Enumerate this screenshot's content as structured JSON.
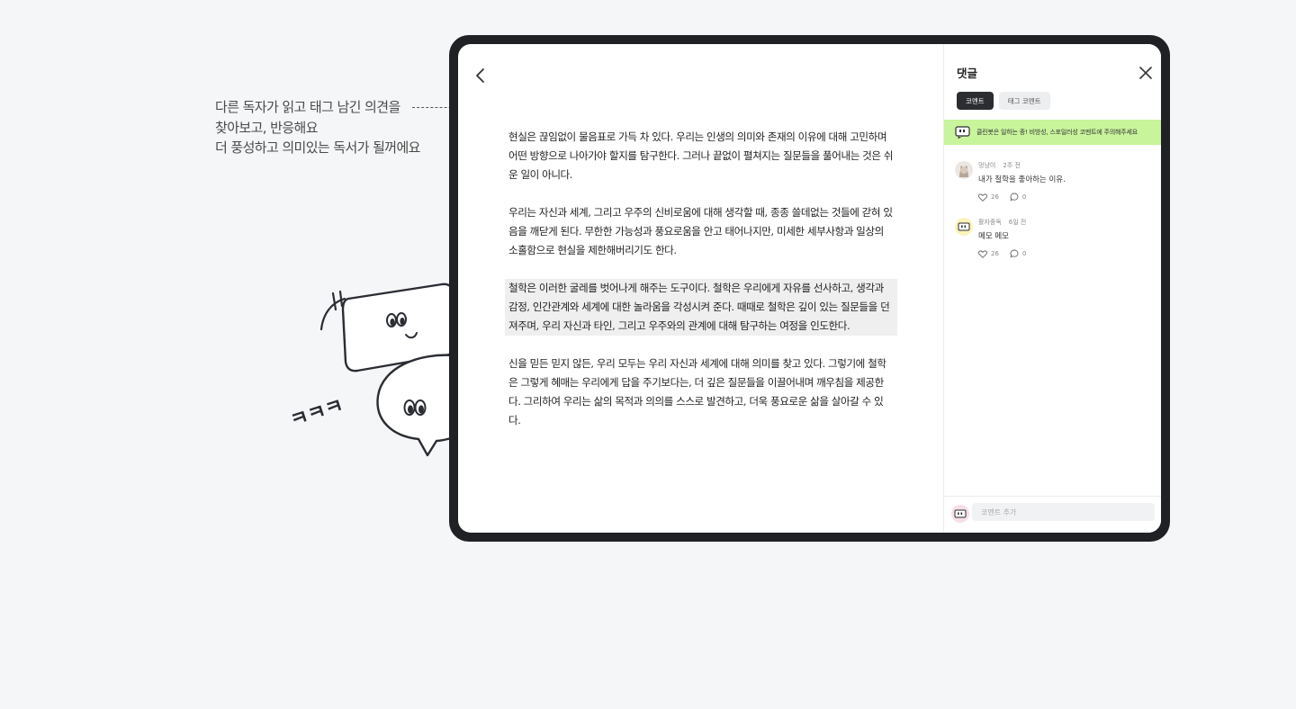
{
  "caption": {
    "lines": [
      "다른 독자가 읽고 태그 남긴 의견을",
      "찾아보고, 반응해요",
      "더 풍성하고 의미있는 독서가 될꺼에요"
    ]
  },
  "accent_color": "#5ddc2a",
  "notice_color": "#c8f49c",
  "mascot": {
    "laugh_text": "ㅋㅋㅋ"
  },
  "reader": {
    "back_icon": "chevron-left-icon",
    "paragraphs": [
      {
        "text": "현실은 끊임없이 물음표로 가득 차 있다. 우리는 인생의 의미와 존재의 이유에 대해 고민하며 어떤 방향으로 나아가야 할지를 탐구한다. 그러나 끝없이 펼쳐지는 질문들을 풀어내는 것은 쉬운 일이 아니다.",
        "highlighted": false
      },
      {
        "text": "우리는 자신과 세계, 그리고 우주의 신비로움에 대해 생각할 때, 종종 쓸데없는 것들에 갇혀 있음을 깨닫게 된다. 무한한 가능성과 풍요로움을 안고 태어나지만, 미세한 세부사항과 일상의 소홀함으로 현실을 제한해버리기도 한다.",
        "highlighted": false
      },
      {
        "text": "철학은 이러한 굴레를 벗어나게 해주는 도구이다. 철학은 우리에게 자유를 선사하고, 생각과 감정, 인간관계와 세계에 대한 놀라움을 각성시켜 준다. 때때로 철학은 깊이 있는 질문들을 던져주며, 우리 자신과 타인, 그리고 우주와의 관계에 대해 탐구하는 여정을 인도한다.",
        "highlighted": true
      },
      {
        "text": "신을 믿든 믿지 않든, 우리 모두는 우리 자신과 세계에 대해 의미를 찾고 있다. 그렇기에 철학은 그렇게 혜매는 우리에게 답을 주기보다는, 더 깊은 질문들을 이끌어내며 깨우침을 제공한다. 그리하여 우리는 삶의 목적과 의의를 스스로 발견하고, 더욱 풍요로운 삶을 살아갈 수 있다.",
        "highlighted": false
      }
    ]
  },
  "comments_panel": {
    "title": "댓글",
    "close_icon": "close-icon",
    "tabs": [
      {
        "label": "코멘트",
        "active": true
      },
      {
        "label": "태그 코멘트",
        "active": false
      }
    ],
    "notice": {
      "icon": "bot-icon",
      "text": "클린봇은 일하는 중! 비방성, 스포일러성 코멘트에 주의해주세요"
    },
    "comments": [
      {
        "author": "멍냥이",
        "time": "2주 전",
        "text": "내가 철학을 좋아하는 이유.",
        "likes": "26",
        "replies": "0",
        "avatar": "cat-avatar"
      },
      {
        "author": "활자중독",
        "time": "6일 전",
        "text": "메모 메모",
        "likes": "26",
        "replies": "0",
        "avatar": "robot-avatar"
      }
    ],
    "input": {
      "placeholder": "코멘트 추가",
      "value": ""
    }
  }
}
